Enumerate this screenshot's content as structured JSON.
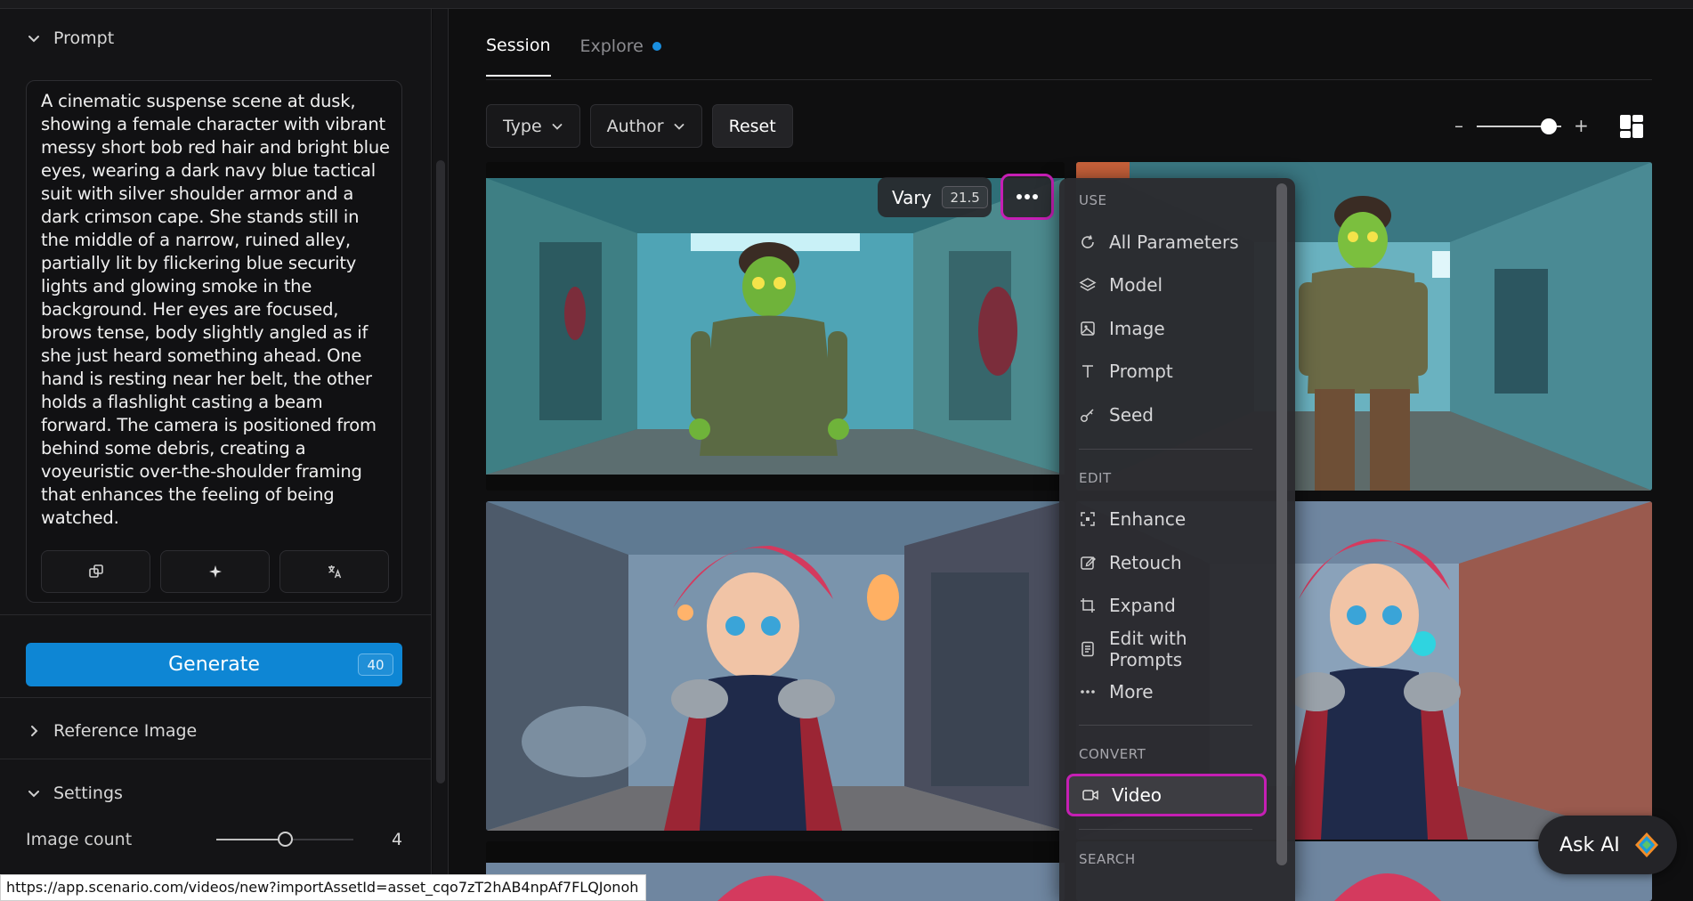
{
  "sidebar": {
    "prompt_section_label": "Prompt",
    "prompt_text": "A cinematic suspense scene at dusk, showing a female character with vibrant messy short bob red hair and bright blue eyes, wearing a dark navy blue tactical suit with silver shoulder armor and a dark crimson cape. She stands still in the middle of a narrow, ruined alley, partially lit by flickering blue security lights and glowing smoke in the background. Her eyes are focused, brows tense, body slightly angled as if she just heard something ahead. One hand is resting near her belt, the other holds a flashlight casting a beam forward. The camera is positioned from behind some debris, creating a voyeuristic over-the-shoulder framing that enhances the feeling of being watched.",
    "generate_label": "Generate",
    "generate_cost": "40",
    "reference_image_label": "Reference Image",
    "settings_label": "Settings",
    "image_count_label": "Image count",
    "image_count_value": "4",
    "image_count_fraction": 0.5
  },
  "status_url": "https://app.scenario.com/videos/new?importAssetId=asset_cqo7zT2hAB4npAf7FLQJonoh",
  "main": {
    "tabs": [
      {
        "label": "Session",
        "active": true
      },
      {
        "label": "Explore",
        "active": false,
        "has_dot": true
      }
    ],
    "filters": {
      "type_label": "Type",
      "author_label": "Author",
      "reset_label": "Reset"
    },
    "zoom": {
      "minus": "–",
      "plus": "+",
      "level": 0.85
    }
  },
  "image_toolbar": {
    "vary_label": "Vary",
    "vary_cost": "21.5"
  },
  "context_menu": {
    "groups": [
      {
        "label": "USE",
        "items": [
          "All Parameters",
          "Model",
          "Image",
          "Prompt",
          "Seed"
        ]
      },
      {
        "label": "EDIT",
        "items": [
          "Enhance",
          "Retouch",
          "Expand",
          "Edit with Prompts",
          "More"
        ]
      },
      {
        "label": "CONVERT",
        "items": [
          "Video"
        ]
      },
      {
        "label": "SEARCH",
        "items": []
      }
    ]
  },
  "ask_ai_label": "Ask AI",
  "colors": {
    "accent": "#0e86d4",
    "highlight": "#c51fb4",
    "tab_dot": "#1a8fe0"
  }
}
